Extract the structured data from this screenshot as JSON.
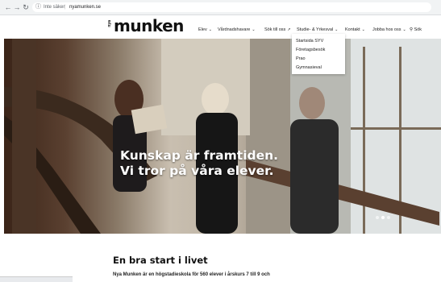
{
  "browser": {
    "info_label": "Inte säker",
    "url": "nyamunken.se"
  },
  "logo": {
    "small": "nya",
    "big": "munken"
  },
  "nav": [
    {
      "label": "Elev",
      "chevron": true
    },
    {
      "label": "Vårdnadshavare",
      "chevron": true
    },
    {
      "label": "Sök till oss",
      "chevron": false
    },
    {
      "label": "Studie- & Yrkesval",
      "chevron": true
    },
    {
      "label": "Kontakt",
      "chevron": true
    },
    {
      "label": "Jobba hos oss",
      "chevron": true
    },
    {
      "label": "Sök",
      "chevron": false
    }
  ],
  "dropdown": {
    "items": [
      "Startsida SYV",
      "Företagsbesök",
      "Prao",
      "Gymnasieval"
    ]
  },
  "hero": {
    "line1": "Kunskap är framtiden.",
    "line2": "Vi tror på våra elever.",
    "slides": 3,
    "active_slide": 2
  },
  "section": {
    "title": "En bra start i livet",
    "intro": "Nya Munken är en högstadieskola för 560 elever i årskurs 7 till 9 och"
  },
  "colors": {
    "text": "#111111",
    "hero_text": "#ffffff"
  }
}
